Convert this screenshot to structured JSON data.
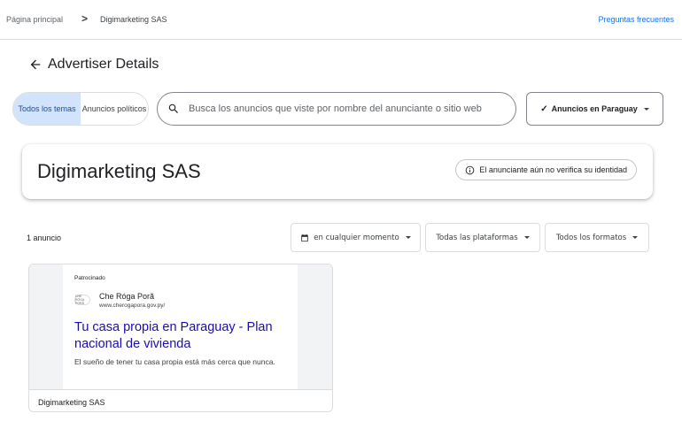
{
  "breadcrumb": {
    "home": "Página principal",
    "separator": ">",
    "current": "Digimarketing SAS"
  },
  "header": {
    "faq_link": "Preguntas frecuentes",
    "back_icon": "arrow-left-icon",
    "title": "Advertiser Details"
  },
  "topic_toggle": {
    "all_topics": "Todos los temas",
    "political": "Anuncios políticos",
    "selected": "Todos los temas"
  },
  "search": {
    "icon": "search-icon",
    "placeholder": "Busca los anuncios que viste por nombre del anunciante o sitio web",
    "value": ""
  },
  "region_filter": {
    "check": "✓",
    "label": "Anuncios en Paraguay"
  },
  "advertiser": {
    "name": "Digimarketing SAS",
    "verification_text": "El anunciante aún no verifica su identidad",
    "verification_icon": "info-icon"
  },
  "results": {
    "count_text": "1 anuncio"
  },
  "filters": {
    "date": "en cualquier momento",
    "platforms": "Todas las plataformas",
    "formats": "Todos los formatos"
  },
  "ads": [
    {
      "sponsored_label": "Patrocinado",
      "logo_text": "CHE RÓGA PORÃ",
      "advertiser": "Che Róga Porã",
      "url": "www.cherogapora.gov.py/",
      "headline": "Tu casa propia en Paraguay - Plan nacional de vivienda",
      "description": "El sueño de tener tu casa propia está más cerca que nunca.",
      "footer_advertiser": "Digimarketing SAS"
    }
  ],
  "colors": {
    "accent": "#1a73e8",
    "toggle_active_bg": "#d2e3fc",
    "headline_link": "#1a0dab"
  }
}
